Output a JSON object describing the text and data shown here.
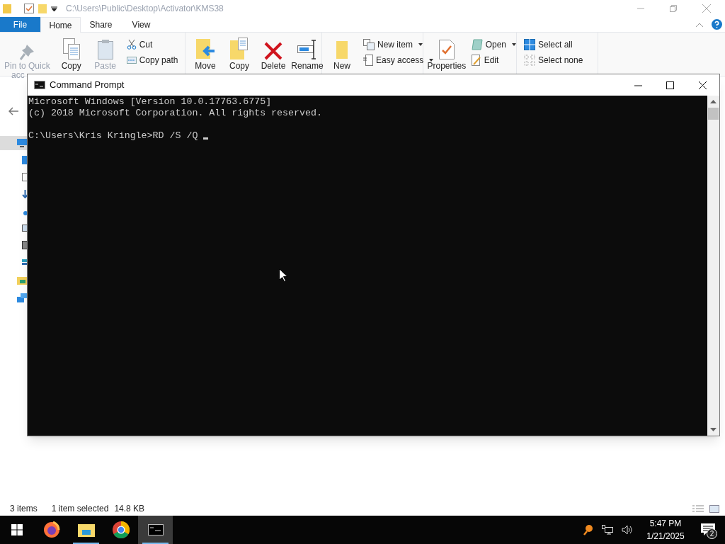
{
  "explorer": {
    "path": "C:\\Users\\Public\\Desktop\\Activator\\KMS38",
    "tabs": [
      {
        "label": "File",
        "kind": "file",
        "selected": false
      },
      {
        "label": "Home",
        "kind": "tab",
        "selected": true
      },
      {
        "label": "Share",
        "kind": "tab",
        "selected": false
      },
      {
        "label": "View",
        "kind": "tab",
        "selected": false
      }
    ],
    "ribbon": [
      {
        "items": [
          {
            "kind": "large",
            "label": "Pin to Quick",
            "label2": "acc",
            "disabled": true
          },
          {
            "kind": "large",
            "label": "Copy",
            "disabled": false
          },
          {
            "kind": "large",
            "label": "Paste",
            "disabled": true
          },
          {
            "kind": "small",
            "rows": [
              {
                "label": "Cut",
                "dropdown": false
              },
              {
                "label": "Copy path",
                "dropdown": false
              }
            ]
          }
        ]
      },
      {
        "items": [
          {
            "kind": "large",
            "label": "Move",
            "disabled": false
          },
          {
            "kind": "large",
            "label": "Copy",
            "disabled": false
          },
          {
            "kind": "large",
            "label": "Delete",
            "disabled": false
          },
          {
            "kind": "large",
            "label": "Rename",
            "disabled": false
          }
        ]
      },
      {
        "items": [
          {
            "kind": "large",
            "label": "New",
            "disabled": false
          },
          {
            "kind": "small",
            "rows": [
              {
                "label": "New item",
                "dropdown": true
              },
              {
                "label": "Easy access",
                "dropdown": true
              }
            ]
          }
        ]
      },
      {
        "items": [
          {
            "kind": "large",
            "label": "Properties",
            "disabled": false
          },
          {
            "kind": "small",
            "rows": [
              {
                "label": "Open",
                "dropdown": true
              },
              {
                "label": "Edit",
                "dropdown": false
              }
            ]
          }
        ]
      },
      {
        "items": [
          {
            "kind": "small",
            "rows": [
              {
                "label": "Select all",
                "dropdown": false
              },
              {
                "label": "Select none",
                "dropdown": false
              }
            ]
          }
        ]
      }
    ],
    "status_bar": {
      "items": "3 items",
      "selection": "1 item selected",
      "size": "14.8 KB"
    }
  },
  "cmd": {
    "title": "Command Prompt",
    "lines": [
      {
        "kind": "output",
        "text": "Microsoft Windows [Version 10.0.17763.6775]"
      },
      {
        "kind": "output",
        "text": "(c) 2018 Microsoft Corporation. All rights reserved."
      },
      {
        "kind": "blank"
      },
      {
        "kind": "prompt",
        "text": "C:\\Users\\Kris Kringle>RD /S /Q "
      }
    ],
    "cursor": true
  },
  "taskbar": {
    "apps": [
      {
        "kind": "firefox",
        "running": false,
        "active": false
      },
      {
        "kind": "explorer",
        "running": true,
        "active": false
      },
      {
        "kind": "chrome",
        "running": false,
        "active": false
      },
      {
        "kind": "cmd",
        "running": true,
        "active": true
      }
    ],
    "time": "5:47 PM",
    "date": "1/21/2025",
    "notifications": "2"
  }
}
